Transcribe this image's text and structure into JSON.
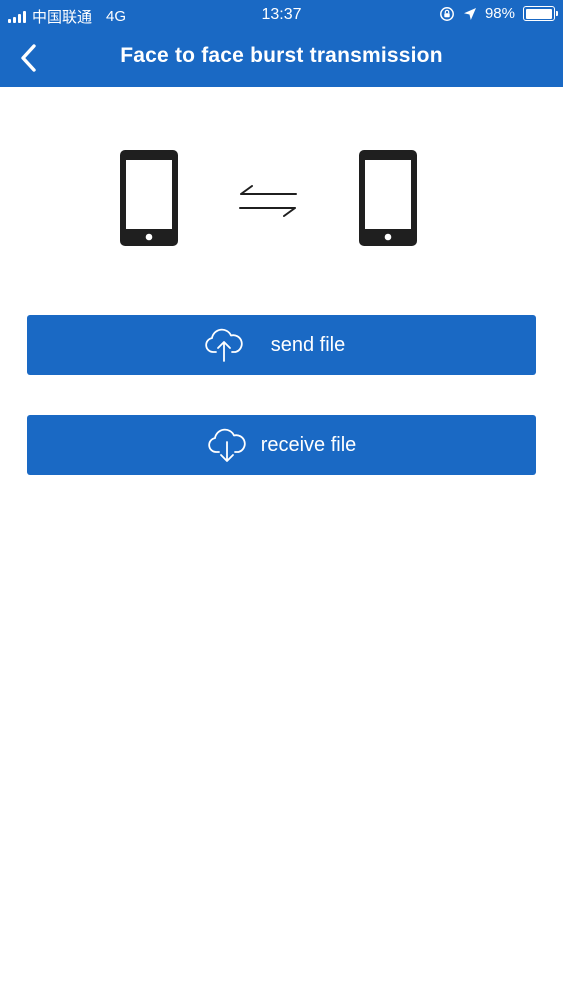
{
  "status_bar": {
    "carrier": "中国联通",
    "network": "4G",
    "time": "13:37",
    "battery_percent": "98%",
    "battery_level": 0.98
  },
  "nav": {
    "title": "Face to face burst transmission",
    "back_icon": "chevron-left-icon"
  },
  "illustration": {
    "left_device_icon": "smartphone-icon",
    "transfer_icon": "swap-arrows-icon",
    "right_device_icon": "smartphone-icon"
  },
  "actions": {
    "send": {
      "label": "send file",
      "icon": "cloud-upload-icon"
    },
    "receive": {
      "label": "receive file",
      "icon": "cloud-download-icon"
    }
  },
  "colors": {
    "primary": "#1a69c4",
    "background": "#ffffff",
    "icon_dark": "#1f1f1f"
  }
}
